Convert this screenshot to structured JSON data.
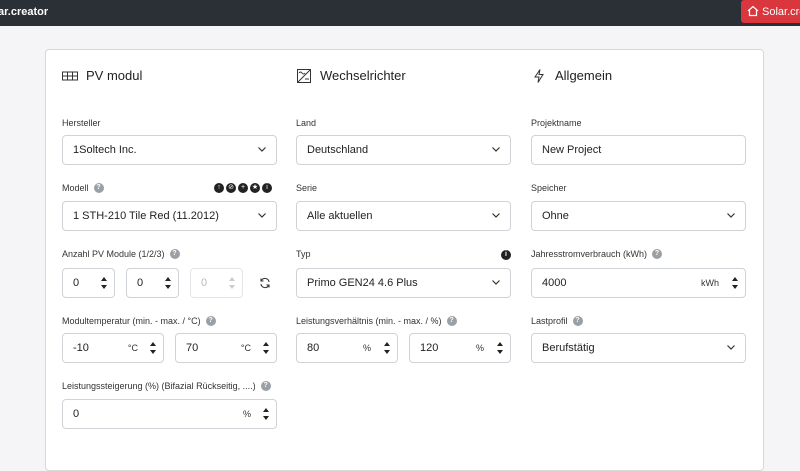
{
  "app": {
    "brand": "ar.creator",
    "home_button": "Solar.crea"
  },
  "sections": {
    "pv": {
      "title": "PV modul"
    },
    "inverter": {
      "title": "Wechselrichter"
    },
    "general": {
      "title": "Allgemein"
    }
  },
  "pv": {
    "hersteller_label": "Hersteller",
    "hersteller_value": "1Soltech Inc.",
    "modell_label": "Modell",
    "modell_value": "1 STH-210 Tile Red (11.2012)",
    "anzahl_label": "Anzahl PV Module (1/2/3)",
    "anzahl_values": [
      "0",
      "0",
      "0"
    ],
    "temp_label": "Modultemperatur (min. - max. / °C)",
    "temp_min": "-10",
    "temp_max": "70",
    "temp_unit": "°C",
    "gain_label": "Leistungssteigerung (%) (Bifazial Rückseitig, ....)",
    "gain_value": "0",
    "gain_unit": "%",
    "model_icons": [
      "↑",
      "⊘",
      "+",
      "★",
      "i"
    ]
  },
  "inverter": {
    "land_label": "Land",
    "land_value": "Deutschland",
    "serie_label": "Serie",
    "serie_value": "Alle aktuellen",
    "typ_label": "Typ",
    "typ_value": "Primo GEN24 4.6 Plus",
    "ratio_label": "Leistungsverhältnis (min. - max. / %)",
    "ratio_min": "80",
    "ratio_max": "120",
    "ratio_unit": "%",
    "info": "i"
  },
  "general": {
    "projekt_label": "Projektname",
    "projekt_value": "New Project",
    "speicher_label": "Speicher",
    "speicher_value": "Ohne",
    "verbrauch_label": "Jahresstromverbrauch (kWh)",
    "verbrauch_value": "4000",
    "verbrauch_unit": "kWh",
    "lastprofil_label": "Lastprofil",
    "lastprofil_value": "Berufstätig"
  },
  "help_glyph": "?",
  "colors": {
    "topbar": "#2b2f36",
    "accent": "#d9363e"
  }
}
